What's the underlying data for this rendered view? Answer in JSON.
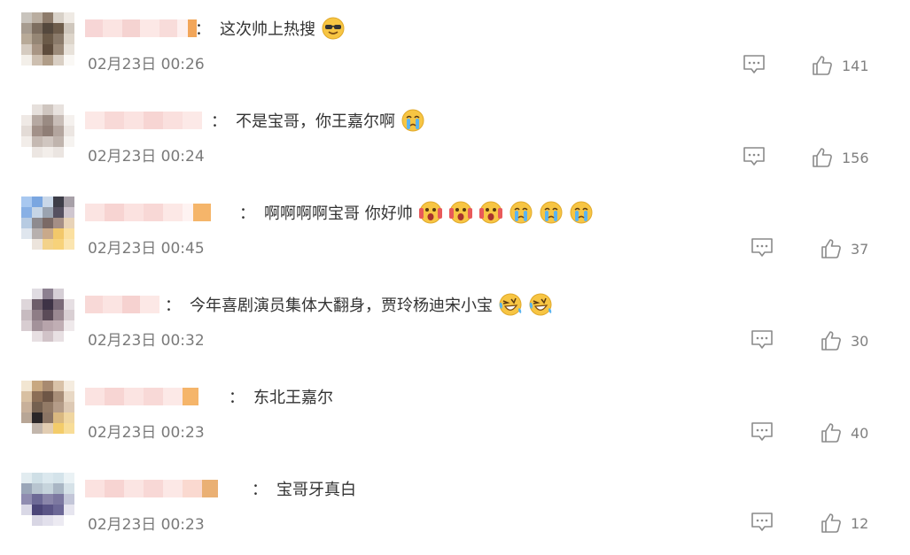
{
  "colors": {
    "text": "#333333",
    "time": "#7a7a7a",
    "icon": "#8a8a8a",
    "background": "#ffffff"
  },
  "comments": [
    {
      "text": "这次帅上热搜",
      "emojis": [
        "cool-emoji"
      ],
      "time": "02月23日 00:26",
      "likes": "141"
    },
    {
      "text": "不是宝哥，你王嘉尔啊",
      "emojis": [
        "crying-emoji"
      ],
      "time": "02月23日 00:24",
      "likes": "156"
    },
    {
      "text": "啊啊啊啊宝哥 你好帅",
      "emojis": [
        "scream-emoji",
        "scream-emoji",
        "scream-emoji",
        "crying-emoji",
        "crying-emoji",
        "crying-emoji"
      ],
      "time": "02月23日 00:45",
      "likes": "37"
    },
    {
      "text": "今年喜剧演员集体大翻身，贾玲杨迪宋小宝",
      "emojis": [
        "laugh-cry-emoji",
        "laugh-cry-emoji"
      ],
      "time": "02月23日 00:32",
      "likes": "30"
    },
    {
      "text": "东北王嘉尔",
      "emojis": [],
      "time": "02月23日 00:23",
      "likes": "40"
    },
    {
      "text": "宝哥牙真白",
      "emojis": [],
      "time": "02月23日 00:23",
      "likes": "12"
    }
  ]
}
